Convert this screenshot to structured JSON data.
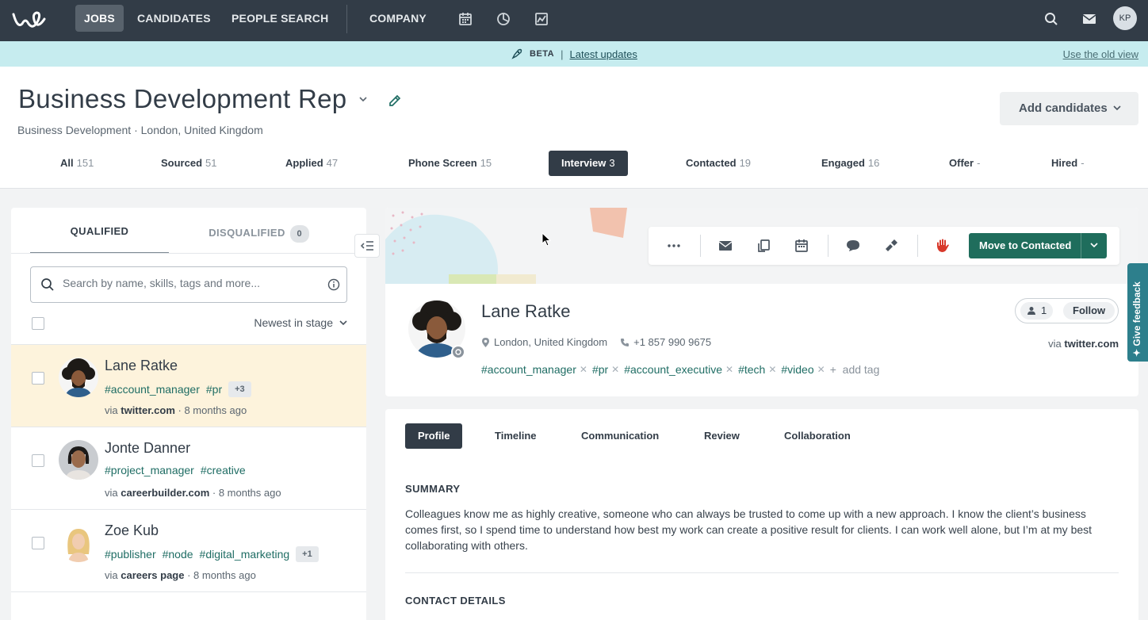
{
  "nav": {
    "items": [
      "JOBS",
      "CANDIDATES",
      "PEOPLE SEARCH",
      "COMPANY"
    ],
    "active": "JOBS",
    "icons": [
      "calendar-icon",
      "pie-chart-icon",
      "line-chart-icon",
      "search-icon",
      "mail-icon"
    ],
    "avatar_initials": "KP"
  },
  "beta": {
    "tag": "BETA",
    "sep": "|",
    "link": "Latest updates",
    "old_view": "Use the old view"
  },
  "job": {
    "title": "Business Development Rep",
    "subtitle": "Business Development · London, United Kingdom",
    "add_candidates": "Add candidates"
  },
  "stages": [
    {
      "label": "All",
      "count": "151"
    },
    {
      "label": "Sourced",
      "count": "51"
    },
    {
      "label": "Applied",
      "count": "47"
    },
    {
      "label": "Phone Screen",
      "count": "15"
    },
    {
      "label": "Interview",
      "count": "3",
      "active": true
    },
    {
      "label": "Contacted",
      "count": "19"
    },
    {
      "label": "Engaged",
      "count": "16"
    },
    {
      "label": "Offer",
      "count": "-"
    },
    {
      "label": "Hired",
      "count": "-"
    }
  ],
  "list": {
    "tab_qualified": "QUALIFIED",
    "tab_disqualified": "DISQUALIFIED",
    "disqualified_count": "0",
    "search_placeholder": "Search by name, skills, tags and more...",
    "sort": "Newest in stage",
    "candidates": [
      {
        "name": "Lane Ratke",
        "tags": [
          "#account_manager",
          "#pr"
        ],
        "more": "+3",
        "via_prefix": "via",
        "source": "twitter.com",
        "time": "· 8 months ago",
        "selected": true
      },
      {
        "name": "Jonte Danner",
        "tags": [
          "#project_manager",
          "#creative"
        ],
        "more": "",
        "via_prefix": "via",
        "source": "careerbuilder.com",
        "time": "· 8 months ago"
      },
      {
        "name": "Zoe Kub",
        "tags": [
          "#publisher",
          "#node",
          "#digital_marketing"
        ],
        "more": "+1",
        "via_prefix": "via",
        "source": "careers page",
        "time": "· 8 months ago"
      }
    ]
  },
  "profile": {
    "name": "Lane Ratke",
    "location": "London, United Kingdom",
    "phone": "+1 857 990 9675",
    "tags": [
      "#account_manager",
      "#pr",
      "#account_executive",
      "#tech",
      "#video"
    ],
    "add_tag": "add tag",
    "followers": "1",
    "follow": "Follow",
    "via_prefix": "via",
    "source": "twitter.com",
    "move_button": "Move to Contacted"
  },
  "detail": {
    "tabs": [
      "Profile",
      "Timeline",
      "Communication",
      "Review",
      "Collaboration"
    ],
    "active_tab": "Profile",
    "summary_title": "SUMMARY",
    "summary": "Colleagues know me as highly creative, someone who can always be trusted to come up with a new approach. I know the client’s business comes first, so I spend time to understand how best my work can create a positive result for clients. I can work well alone, but I’m at my best collaborating with others.",
    "contact_title": "CONTACT DETAILS"
  },
  "feedback": "✦ Give feedback",
  "colors": {
    "nav_bg": "#323c47",
    "beta_bg": "#c6ecef",
    "primary_green": "#1f6d5c",
    "tag_green": "#1f6d64",
    "selected_row": "#fdf3dc",
    "feedback_bg": "#2d7f8c"
  }
}
